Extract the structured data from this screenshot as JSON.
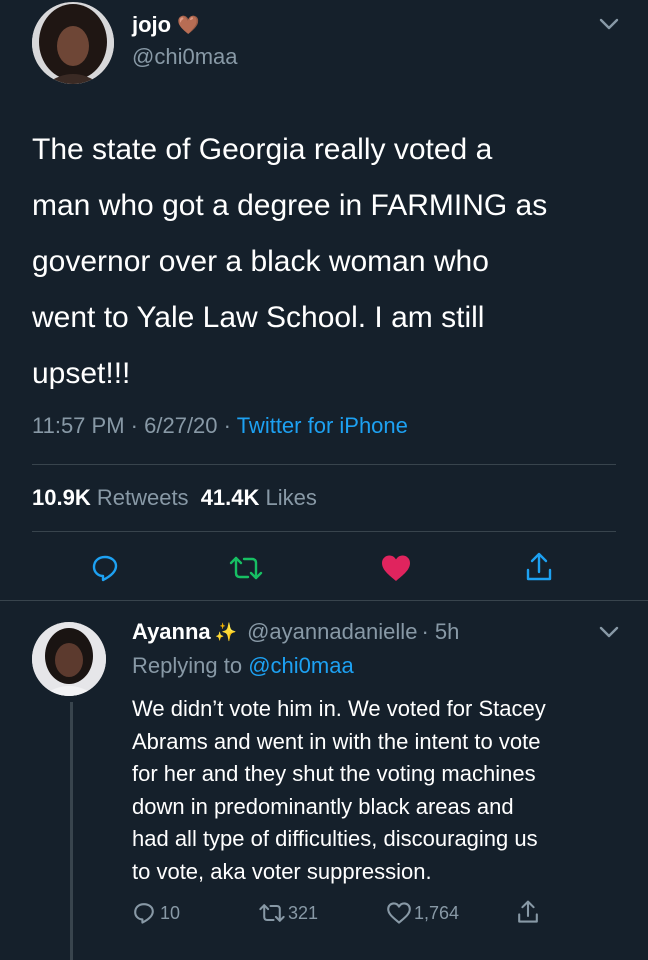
{
  "main_tweet": {
    "display_name": "jojo",
    "emoji": "🤎",
    "handle": "@chi0maa",
    "text_lines": [
      "The state of Georgia really voted a",
      "man who got a degree in FARMING as",
      "governor over a black woman who",
      "went to Yale Law School. I am still",
      "upset!!!"
    ],
    "time": "11:57 PM",
    "date": "6/27/20",
    "separator": "·",
    "source": "Twitter for iPhone",
    "retweets_count": "10.9K",
    "retweets_label": "Retweets",
    "likes_count": "41.4K",
    "likes_label": "Likes",
    "liked": true
  },
  "reply": {
    "display_name": "Ayanna",
    "emoji": "✨",
    "handle": "@ayannadanielle",
    "age": "· 5h",
    "replying_prefix": "Replying to",
    "replying_handle": "@chi0maa",
    "text_lines": [
      "We didn’t vote him in. We voted for Stacey",
      "Abrams and went in with the intent to vote",
      "for her and they shut the voting machines",
      "down in predominantly black areas and",
      "had all type of difficulties, discouraging us",
      "to vote, aka voter suppression."
    ],
    "replies": "10",
    "retweets": "321",
    "likes": "1,764"
  },
  "colors": {
    "background": "#15202b",
    "muted": "#8899a6",
    "accent": "#1da1f2",
    "retweet": "#17bf63",
    "like": "#e0245e"
  }
}
